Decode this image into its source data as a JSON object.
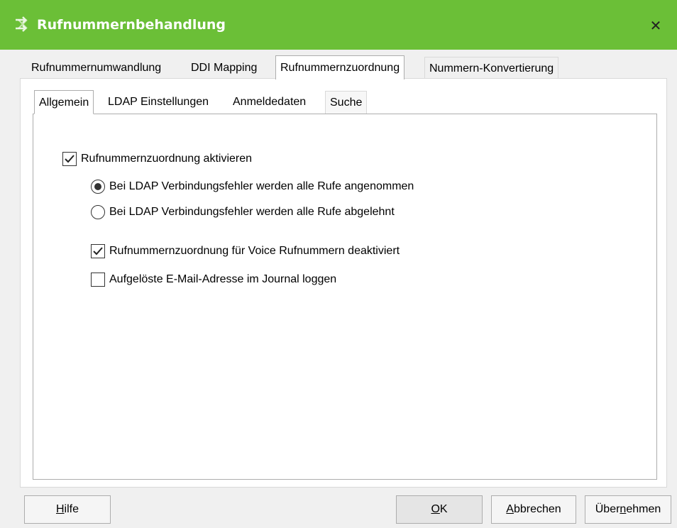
{
  "window": {
    "title": "Rufnummernbehandlung",
    "app_icon": "arrows-icon",
    "close_glyph": "✕"
  },
  "top_tabs": [
    {
      "label": "Rufnummernumwandlung",
      "active": false
    },
    {
      "label": "DDI Mapping",
      "active": false
    },
    {
      "label": "Rufnummernzuordnung",
      "active": true
    },
    {
      "label": "Nummern-Konvertierung",
      "active": false
    }
  ],
  "sub_tabs": [
    {
      "label": "Allgemein",
      "active": true
    },
    {
      "label": "LDAP Einstellungen",
      "active": false
    },
    {
      "label": "Anmeldedaten",
      "active": false
    },
    {
      "label": "Suche",
      "active": false
    }
  ],
  "options": {
    "enable": {
      "label": "Rufnummernzuordnung aktivieren",
      "checked": true
    },
    "radio_accept": {
      "label": "Bei LDAP Verbindungsfehler werden alle Rufe angenommen",
      "selected": true
    },
    "radio_reject": {
      "label": "Bei LDAP Verbindungsfehler werden alle Rufe abgelehnt",
      "selected": false
    },
    "voice_disabled": {
      "label": "Rufnummernzuordnung für Voice Rufnummern deaktiviert",
      "checked": true
    },
    "log_email": {
      "label": "Aufgelöste E-Mail-Adresse im Journal loggen",
      "checked": false
    }
  },
  "buttons": {
    "help": {
      "prefix": "",
      "accel": "H",
      "suffix": "ilfe"
    },
    "ok": {
      "prefix": "",
      "accel": "O",
      "suffix": "K"
    },
    "cancel": {
      "prefix": "",
      "accel": "A",
      "suffix": "bbrechen"
    },
    "apply": {
      "prefix": "Über",
      "accel": "n",
      "suffix": "ehmen"
    }
  },
  "colors": {
    "titlebar": "#6bbf37",
    "title_text": "#ffffff"
  }
}
